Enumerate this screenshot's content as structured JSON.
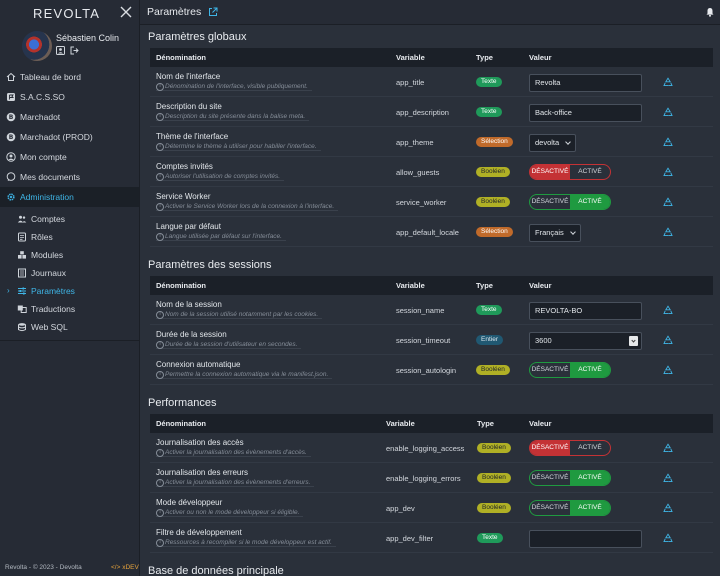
{
  "app": {
    "brand": "REVOLTA",
    "page_title": "Paramètres",
    "user_name": "Sébastien Colin",
    "footer": "Revolta - © 2023 - Devolta",
    "footer_dev": "</> xDEV"
  },
  "nav": [
    {
      "label": "Tableau de bord",
      "icon": "home-icon"
    },
    {
      "label": "S.A.C.S.SO",
      "icon": "flag-icon"
    },
    {
      "label": "Marchadot",
      "icon": "bitcoin-icon"
    },
    {
      "label": "Marchadot (PROD)",
      "icon": "bitcoin-icon"
    },
    {
      "label": "Mon compte",
      "icon": "user-circle-icon"
    },
    {
      "label": "Mes documents",
      "icon": "chat-icon"
    },
    {
      "label": "Administration",
      "icon": "gear-icon"
    }
  ],
  "subnav": [
    {
      "label": "Comptes",
      "icon": "users-icon"
    },
    {
      "label": "Rôles",
      "icon": "roles-icon"
    },
    {
      "label": "Modules",
      "icon": "cubes-icon"
    },
    {
      "label": "Journaux",
      "icon": "log-icon"
    },
    {
      "label": "Paramètres",
      "icon": "sliders-icon"
    },
    {
      "label": "Traductions",
      "icon": "translate-icon"
    },
    {
      "label": "Web SQL",
      "icon": "database-icon"
    }
  ],
  "headers": {
    "name": "Dénomination",
    "var": "Variable",
    "type": "Type",
    "value": "Valeur"
  },
  "toggle_labels": {
    "off": "DÉSACTIVÉ",
    "on": "ACTIVÉ"
  },
  "sections": [
    {
      "title": "Paramètres globaux",
      "rows": [
        {
          "name": "Nom de l'interface",
          "desc": "Dénomination de l'interface, visible publiquement.",
          "var": "app_title",
          "type": "Texte",
          "kind": "text",
          "value": "Revolta"
        },
        {
          "name": "Description du site",
          "desc": "Description du site présente dans la balise meta.",
          "var": "app_description",
          "type": "Texte",
          "kind": "text",
          "value": "Back-office"
        },
        {
          "name": "Thème de l'interface",
          "desc": "Détermine le thème à utiliser pour habiller l'interface.",
          "var": "app_theme",
          "type": "Sélection",
          "kind": "select",
          "value": "devolta"
        },
        {
          "name": "Comptes invités",
          "desc": "Autoriser l'utilisation de comptes invités.",
          "var": "allow_guests",
          "type": "Booléen",
          "kind": "toggle",
          "value": false
        },
        {
          "name": "Service Worker",
          "desc": "Activer le Service Worker lors de la connexion à l'interface.",
          "var": "service_worker",
          "type": "Booléen",
          "kind": "toggle",
          "value": true
        },
        {
          "name": "Langue par défaut",
          "desc": "Langue utilisée par défaut sur l'interface.",
          "var": "app_default_locale",
          "type": "Sélection",
          "kind": "select",
          "value": "Français"
        }
      ]
    },
    {
      "title": "Paramètres des sessions",
      "rows": [
        {
          "name": "Nom de la session",
          "desc": "Nom de la session utilisé notamment par les cookies.",
          "var": "session_name",
          "type": "Texte",
          "kind": "text",
          "value": "REVOLTA-BO"
        },
        {
          "name": "Durée de la session",
          "desc": "Durée de la session d'utilisateur en secondes.",
          "var": "session_timeout",
          "type": "Entier",
          "kind": "number",
          "value": "3600"
        },
        {
          "name": "Connexion automatique",
          "desc": "Permettre la connexion automatique via le manifest.json.",
          "var": "session_autologin",
          "type": "Booléen",
          "kind": "toggle",
          "value": true
        }
      ]
    },
    {
      "title": "Performances",
      "rows": [
        {
          "name": "Journalisation des accès",
          "desc": "Activer la journalisation des évènements d'accès.",
          "var": "enable_logging_access",
          "type": "Booléen",
          "kind": "toggle",
          "value": false
        },
        {
          "name": "Journalisation des erreurs",
          "desc": "Activer la journalisation des évènements d'erreurs.",
          "var": "enable_logging_errors",
          "type": "Booléen",
          "kind": "toggle",
          "value": true
        },
        {
          "name": "Mode développeur",
          "desc": "Activer ou non le mode développeur si éligible.",
          "var": "app_dev",
          "type": "Booléen",
          "kind": "toggle",
          "value": true
        },
        {
          "name": "Filtre de développement",
          "desc": "Ressources à recompiler si le mode développeur est actif.",
          "var": "app_dev_filter",
          "type": "Texte",
          "kind": "text",
          "value": ""
        }
      ]
    },
    {
      "title": "Base de données principale",
      "rows": []
    }
  ],
  "colors": {
    "accent": "#3fb6e7",
    "on": "#1f9a40",
    "off": "#c43235"
  }
}
